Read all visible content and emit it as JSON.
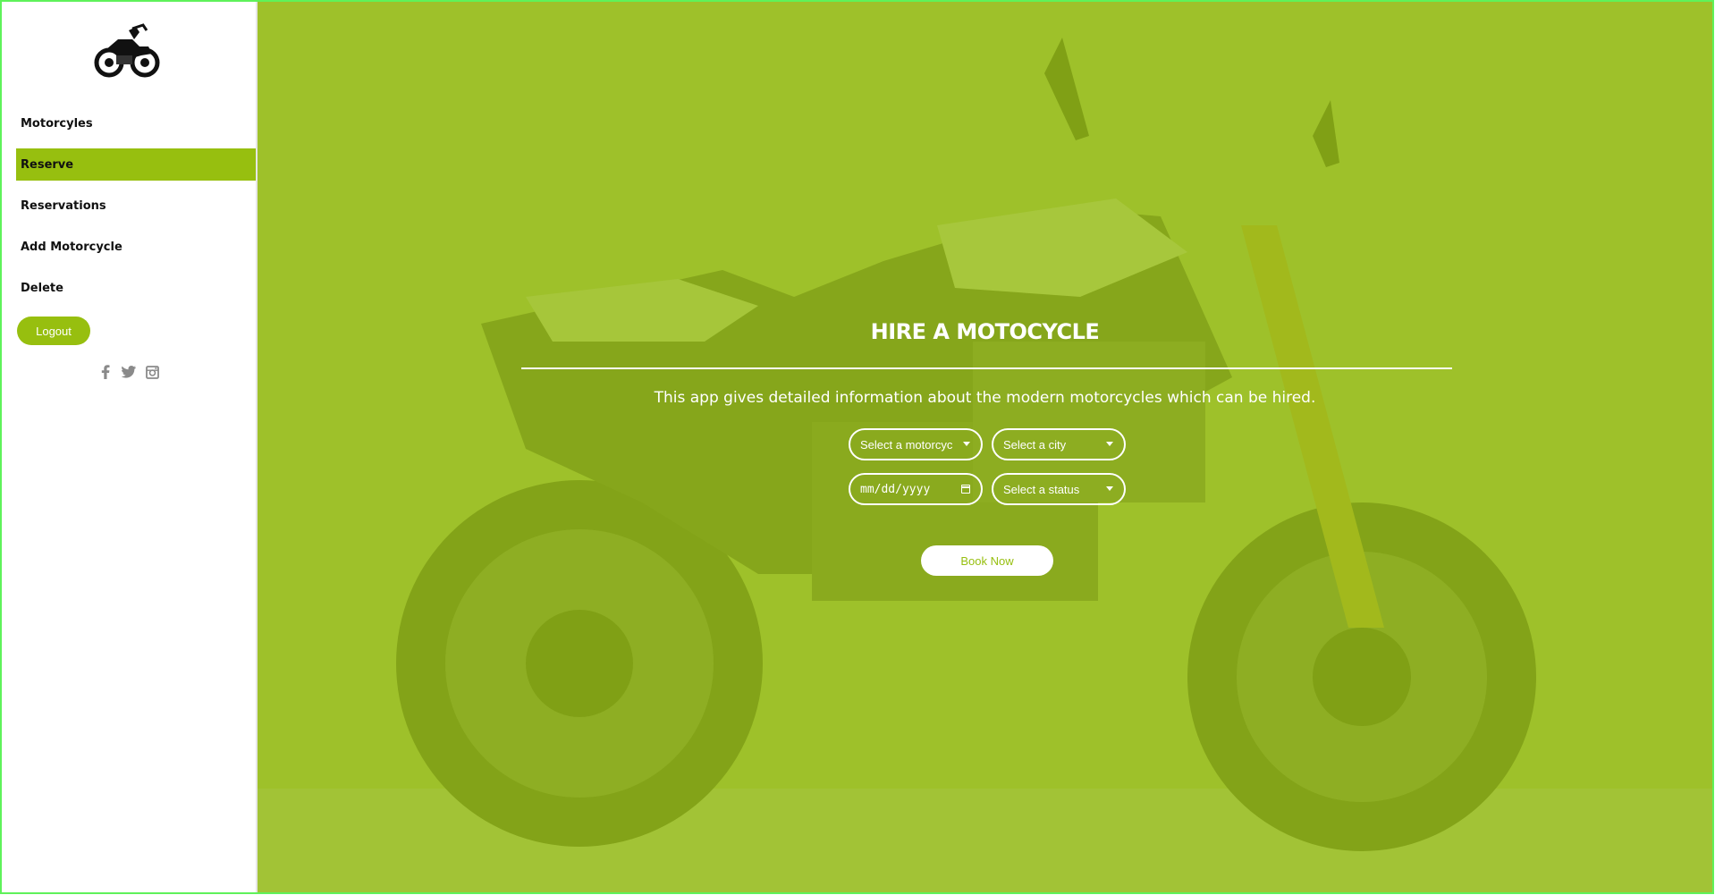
{
  "sidebar": {
    "logo": "motorcycle-logo",
    "items": [
      {
        "label": "Motorcyles",
        "active": false
      },
      {
        "label": "Reserve",
        "active": true
      },
      {
        "label": "Reservations",
        "active": false
      },
      {
        "label": "Add Motorcycle",
        "active": false
      },
      {
        "label": "Delete",
        "active": false
      }
    ],
    "logout_label": "Logout",
    "social": [
      "facebook-icon",
      "twitter-icon",
      "instagram-icon"
    ]
  },
  "main": {
    "title": "HIRE A MOTOCYCLE",
    "subtitle": "This app gives detailed information about the modern motorcycles which can be hired.",
    "form": {
      "motorcycle_select": "Select a motorcyc",
      "city_select": "Select a city",
      "date_placeholder": "mm/dd/yyyy",
      "status_select": "Select a status",
      "submit_label": "Book Now"
    }
  },
  "colors": {
    "accent": "#97bf0f",
    "frame_border": "#5ff25a",
    "text_dark": "#111111",
    "white": "#ffffff"
  }
}
